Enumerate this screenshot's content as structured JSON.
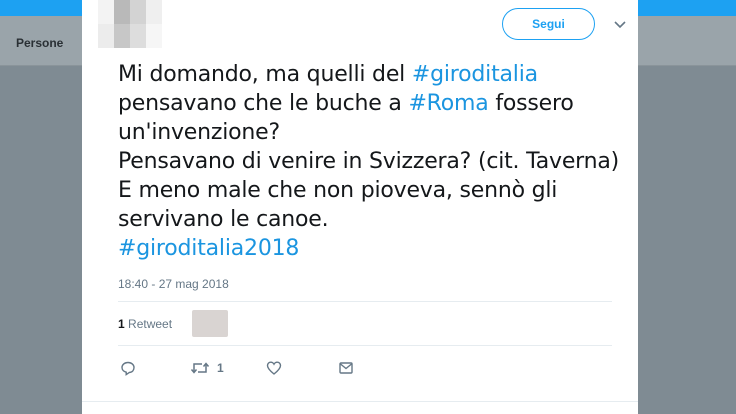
{
  "background": {
    "tab_label": "Persone"
  },
  "tweet": {
    "follow_label": "Segui",
    "lines": [
      [
        {
          "t": "Mi domando, ma quelli del ",
          "h": false
        },
        {
          "t": "#giroditalia",
          "h": true
        }
      ],
      [
        {
          "t": "pensavano che le buche a ",
          "h": false
        },
        {
          "t": "#Roma",
          "h": true
        },
        {
          "t": " fossero",
          "h": false
        }
      ],
      [
        {
          "t": "un'invenzione?",
          "h": false
        }
      ],
      [
        {
          "t": "Pensavano di venire in Svizzera? (cit. Taverna)",
          "h": false
        }
      ],
      [
        {
          "t": "E meno male che non pioveva, sennò gli",
          "h": false
        }
      ],
      [
        {
          "t": "servivano le canoe.",
          "h": false
        }
      ],
      [
        {
          "t": "#giroditalia2018",
          "h": true
        }
      ]
    ],
    "timestamp": "18:40 - 27 mag 2018",
    "retweet_count": "1",
    "retweet_label": " Retweet",
    "actions": {
      "reply_count": "",
      "retweet_count": "1",
      "like_count": ""
    }
  },
  "colors": {
    "accent": "#1da1f2",
    "hashtag": "#1b95e0",
    "text": "#14171a",
    "muted": "#657786"
  }
}
